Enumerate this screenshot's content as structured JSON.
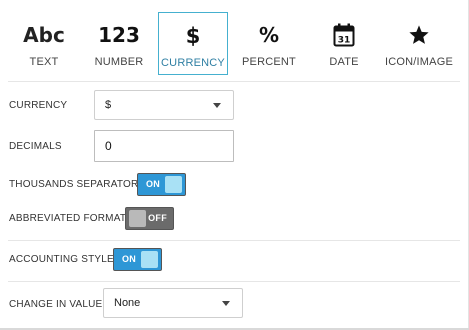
{
  "tabs": [
    {
      "id": "text",
      "glyph": "Abc",
      "label": "TEXT",
      "active": false
    },
    {
      "id": "number",
      "glyph": "123",
      "label": "NUMBER",
      "active": false
    },
    {
      "id": "currency",
      "glyph": "$",
      "label": "CURRENCY",
      "active": true
    },
    {
      "id": "percent",
      "glyph": "%",
      "label": "PERCENT",
      "active": false
    },
    {
      "id": "date",
      "glyph": "31",
      "icon": "calendar-icon",
      "label": "DATE",
      "active": false
    },
    {
      "id": "icon_image",
      "icon": "star-icon",
      "label": "ICON/IMAGE",
      "active": false
    }
  ],
  "settings": {
    "currency": {
      "label": "CURRENCY",
      "value": "$"
    },
    "decimals": {
      "label": "DECIMALS",
      "value": "0"
    },
    "thousands_separator": {
      "label": "THOUSANDS SEPARATOR",
      "state": "ON"
    },
    "abbreviated_format": {
      "label": "ABBREVIATED FORMAT",
      "state": "OFF"
    },
    "accounting_style": {
      "label": "ACCOUNTING STYLE",
      "state": "ON"
    },
    "change_in_value": {
      "label": "CHANGE IN VALUE",
      "value": "None"
    }
  },
  "colors": {
    "accent": "#45b0cf",
    "toggle_on": "#2e97d6",
    "toggle_off": "#6b6b6b"
  }
}
